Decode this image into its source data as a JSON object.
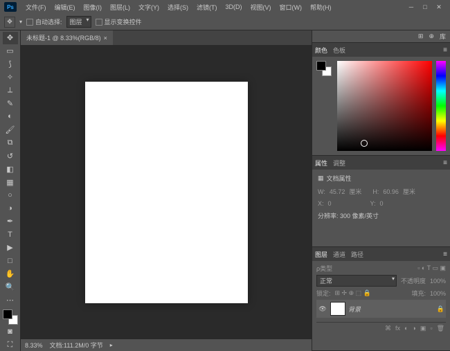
{
  "app": {
    "logo": "Ps"
  },
  "menubar": [
    "文件(F)",
    "编辑(E)",
    "图像(I)",
    "图层(L)",
    "文字(Y)",
    "选择(S)",
    "滤镜(T)",
    "3D(D)",
    "视图(V)",
    "窗口(W)",
    "帮助(H)"
  ],
  "options": {
    "auto_select_label": "自动选择:",
    "auto_select_mode": "图层",
    "show_transform_label": "显示变换控件"
  },
  "document": {
    "tab_title": "未标题-1 @ 8.33%(RGB/8)",
    "zoom": "8.33%",
    "status": "文档:111.2M/0 字节"
  },
  "panels_top_right": {
    "icon1": "⊞",
    "lib": "库"
  },
  "color_panel": {
    "tabs": [
      "颜色",
      "色板"
    ]
  },
  "properties_panel": {
    "tabs": [
      "属性",
      "调整"
    ],
    "title": "文档属性",
    "width_label": "W:",
    "width_value": "45.72",
    "width_unit": "厘米",
    "height_label": "H:",
    "height_value": "60.96",
    "height_unit": "厘米",
    "x_label": "X:",
    "x_value": "0",
    "y_label": "Y:",
    "y_value": "0",
    "resolution": "分辨率: 300 像素/英寸"
  },
  "layers_panel": {
    "tabs": [
      "图层",
      "通道",
      "路径"
    ],
    "kind_label": "ρ类型",
    "blend_mode": "正常",
    "opacity_label": "不透明度",
    "opacity_value": "100%",
    "lock_label": "锁定:",
    "fill_label": "填充:",
    "fill_value": "100%",
    "layer_name": "背景"
  }
}
